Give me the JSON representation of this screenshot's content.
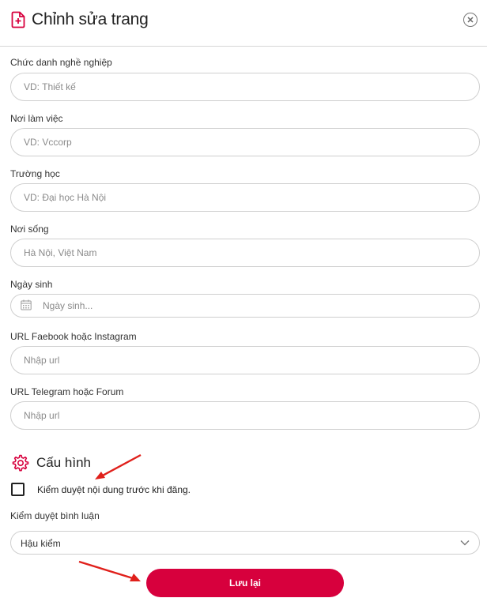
{
  "header": {
    "title": "Chỉnh sửa trang"
  },
  "fields": [
    {
      "label": "Chức danh nghề nghiệp",
      "placeholder": "VD: Thiết kế"
    },
    {
      "label": "Nơi làm việc",
      "placeholder": "VD: Vccorp"
    },
    {
      "label": "Trường học",
      "placeholder": "VD: Đại học Hà Nội"
    },
    {
      "label": "Nơi sống",
      "placeholder": "Hà Nội, Việt Nam"
    },
    {
      "label": "Ngày sinh",
      "placeholder": "Ngày sinh..."
    },
    {
      "label": "URL Faebook hoặc Instagram",
      "placeholder": "Nhập url"
    },
    {
      "label": "URL Telegram hoặc Forum",
      "placeholder": "Nhập url"
    }
  ],
  "config": {
    "title": "Cấu hình",
    "moderate_label": "Kiểm duyệt nội dung trước khi đăng.",
    "comment_label": "Kiểm duyệt bình luận",
    "comment_value": "Hậu kiểm"
  },
  "actions": {
    "save_label": "Lưu lại"
  },
  "colors": {
    "accent": "#d7003d",
    "annotation": "#e0201b"
  },
  "icons": [
    "add-document-icon",
    "close-icon",
    "calendar-icon",
    "gear-icon",
    "chevron-down-icon"
  ]
}
